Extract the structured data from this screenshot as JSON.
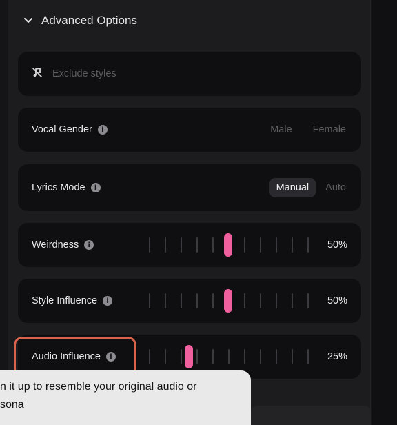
{
  "section": {
    "title": "Advanced Options",
    "icon": "chevron-down-icon"
  },
  "exclude": {
    "placeholder": "Exclude styles",
    "icon": "music-off-icon"
  },
  "vocal_gender": {
    "label": "Vocal Gender",
    "options": [
      "Male",
      "Female"
    ]
  },
  "lyrics_mode": {
    "label": "Lyrics Mode",
    "options": [
      "Manual",
      "Auto"
    ],
    "selected": "Manual"
  },
  "weirdness": {
    "label": "Weirdness",
    "value": "50%",
    "level": 0.5
  },
  "style_influence": {
    "label": "Style Influence",
    "value": "50%",
    "level": 0.5
  },
  "audio_influence": {
    "label": "Audio Influence",
    "value": "25%",
    "level": 0.25
  },
  "tooltip": {
    "line1": "n it up to resemble your original audio or",
    "line2": "sona"
  },
  "colors": {
    "accent": "#f0609e",
    "highlight": "#d9624a"
  }
}
